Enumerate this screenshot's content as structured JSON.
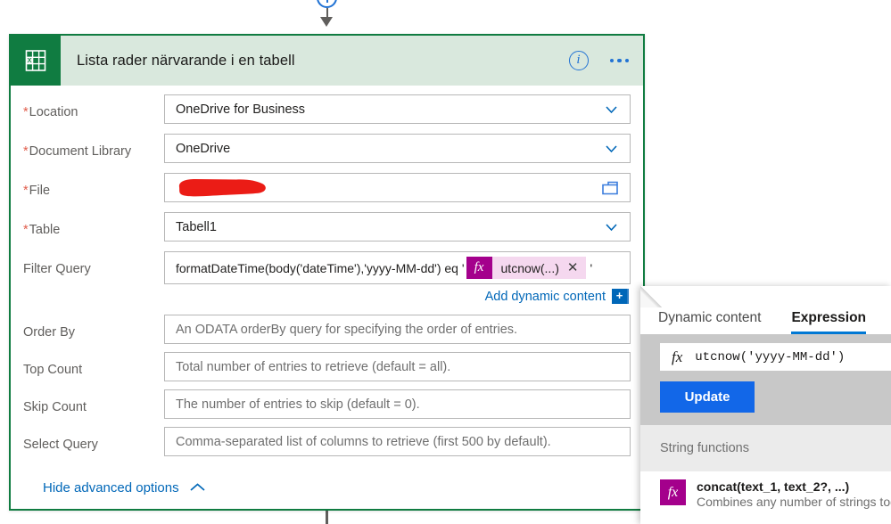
{
  "connector": {
    "add_step_icon": "plus-circle-icon",
    "arrow_icon": "arrow-down-icon"
  },
  "card": {
    "title": "Lista rader närvarande i en tabell",
    "app_icon": "excel-icon",
    "info_icon": "info-icon",
    "more_icon": "ellipsis-icon",
    "accent_color": "#107c41",
    "header_bg": "#d9e8dd"
  },
  "fields": [
    {
      "label": "Location",
      "required": true,
      "value": "OneDrive for Business",
      "control": "dropdown",
      "is_placeholder": false
    },
    {
      "label": "Document Library",
      "required": true,
      "value": "OneDrive",
      "control": "dropdown",
      "is_placeholder": false
    },
    {
      "label": "File",
      "required": true,
      "value": "",
      "control": "file-picker",
      "redacted": true,
      "redaction_color": "#eb1c16",
      "is_placeholder": false
    },
    {
      "label": "Table",
      "required": true,
      "value": "Tabell1",
      "control": "dropdown",
      "is_placeholder": false
    }
  ],
  "filter_query": {
    "label": "Filter Query",
    "required": false,
    "text_before": "formatDateTime(body('dateTime'),'yyyy-MM-dd') eq '",
    "token": {
      "fx_label": "fx",
      "name": "utcnow(...)",
      "remove_icon": "close-icon",
      "badge_color": "#a4008c",
      "chip_color": "#f5d8ef"
    },
    "text_after": "'"
  },
  "add_dynamic": {
    "label": "Add dynamic content",
    "plus_label": "+",
    "link_color": "#0067b8"
  },
  "advanced_fields": [
    {
      "label": "Order By",
      "required": false,
      "value": "An ODATA orderBy query for specifying the order of entries.",
      "control": "text",
      "is_placeholder": true
    },
    {
      "label": "Top Count",
      "required": false,
      "value": "Total number of entries to retrieve (default = all).",
      "control": "text",
      "is_placeholder": true
    },
    {
      "label": "Skip Count",
      "required": false,
      "value": "The number of entries to skip (default = 0).",
      "control": "text",
      "is_placeholder": true
    },
    {
      "label": "Select Query",
      "required": false,
      "value": "Comma-separated list of columns to retrieve (first 500 by default).",
      "control": "text",
      "is_placeholder": true
    }
  ],
  "hide_advanced": {
    "label": "Hide advanced options",
    "chevron_icon": "chevron-up-icon"
  },
  "panel": {
    "tabs": [
      {
        "label": "Dynamic content",
        "active": false
      },
      {
        "label": "Expression",
        "active": true
      }
    ],
    "expression_input": {
      "fx_label": "fx",
      "value": "utcnow('yyyy-MM-dd')"
    },
    "update_button": "Update",
    "functions_heading": "String functions",
    "functions": [
      {
        "fx_label": "fx",
        "name": "concat(text_1, text_2?, ...)",
        "description": "Combines any number of strings tog"
      }
    ],
    "accent_color": "#0078d4",
    "button_color": "#1267e8"
  }
}
